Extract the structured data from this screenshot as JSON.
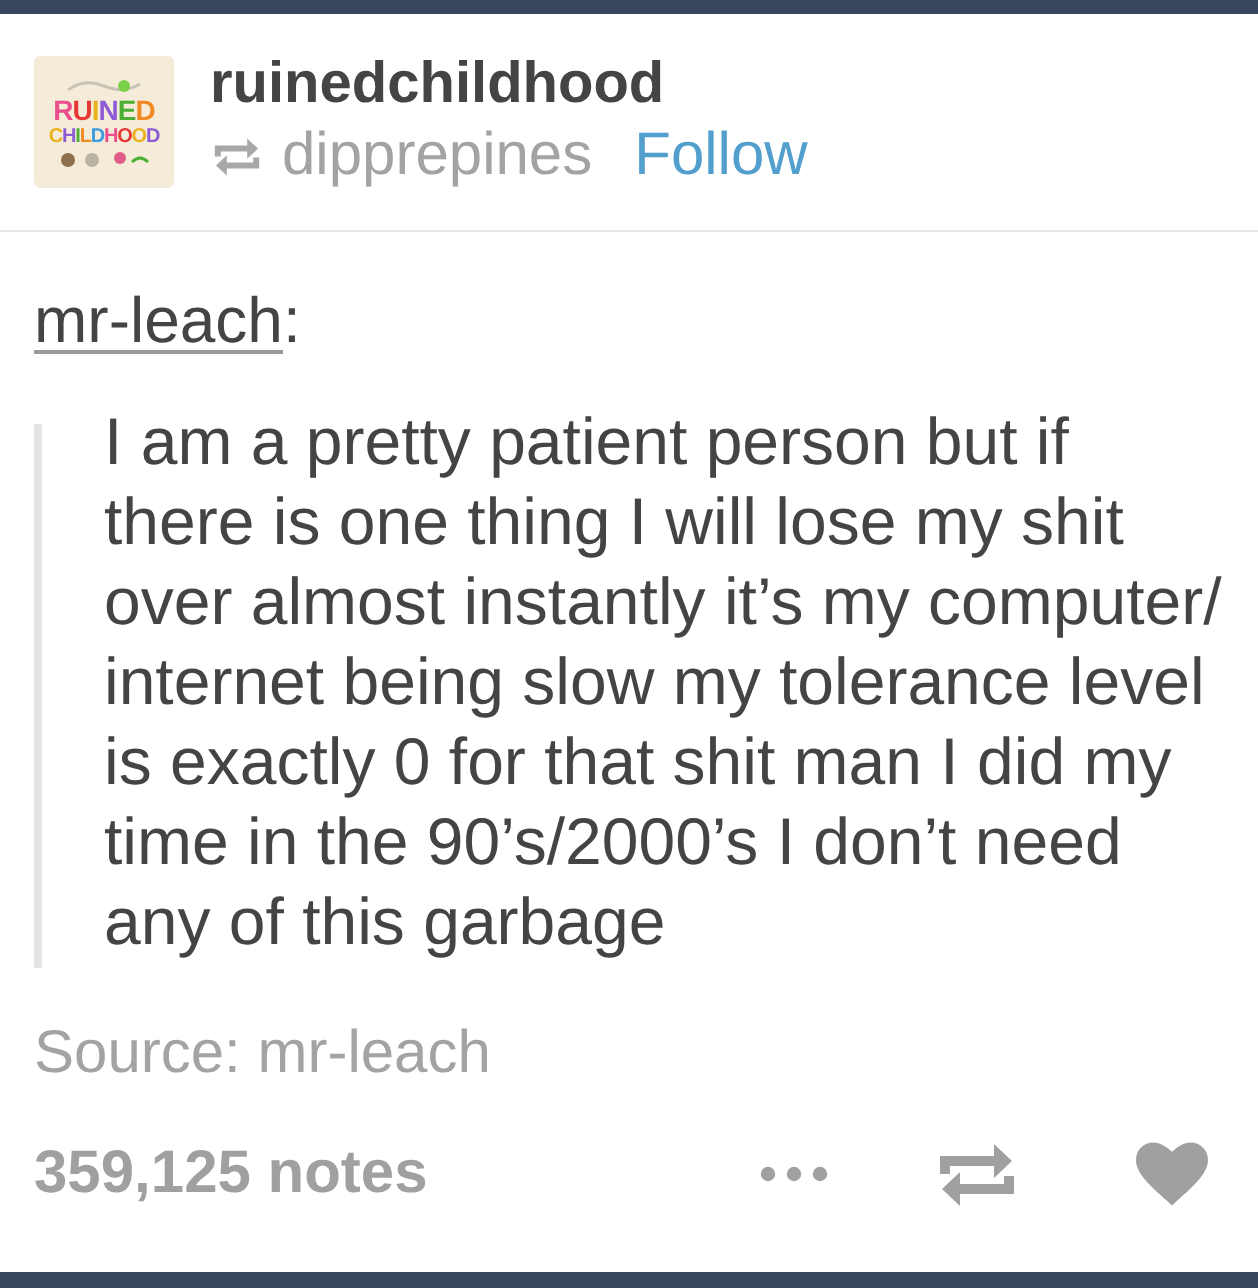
{
  "post": {
    "avatar": {
      "logo_lines": [
        "RUINED",
        "CHILDHOOD"
      ]
    },
    "blog_name": "ruinedchildhood",
    "reblogged_from": "dipprepines",
    "follow_label": "Follow"
  },
  "quote": {
    "author": "mr-leach",
    "author_suffix": ":",
    "lines": [
      "I am a pretty patient person but if",
      "there is one thing I will lose my shit",
      "over almost instantly it’s my computer/",
      "internet being slow my tolerance level",
      "is exactly 0 for that shit man I did my",
      "time in the 90’s/2000’s I don’t need",
      "any of this garbage"
    ]
  },
  "source": "Source: mr-leach",
  "footer": {
    "notes": "359,125 notes"
  }
}
